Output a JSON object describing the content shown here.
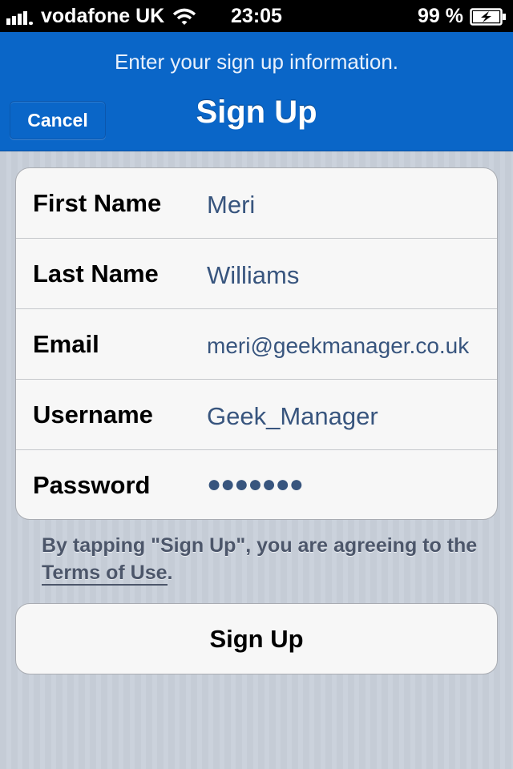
{
  "status_bar": {
    "carrier": "vodafone UK",
    "time": "23:05",
    "battery": "99 %"
  },
  "nav": {
    "prompt": "Enter your sign up information.",
    "title": "Sign Up",
    "cancel_label": "Cancel"
  },
  "form": {
    "rows": [
      {
        "label": "First Name",
        "value": "Meri"
      },
      {
        "label": "Last Name",
        "value": "Williams"
      },
      {
        "label": "Email",
        "value": "meri@geekmanager.co.uk"
      },
      {
        "label": "Username",
        "value": "Geek_Manager"
      },
      {
        "label": "Password",
        "value": "●●●●●●●"
      }
    ]
  },
  "terms": {
    "text_before": "By tapping \"Sign Up\", you are agreeing to the ",
    "link": "Terms of Use",
    "text_after": "."
  },
  "signup_button_label": "Sign Up",
  "colors": {
    "nav_blue": "#0a66c8",
    "value_text": "#38557e"
  }
}
